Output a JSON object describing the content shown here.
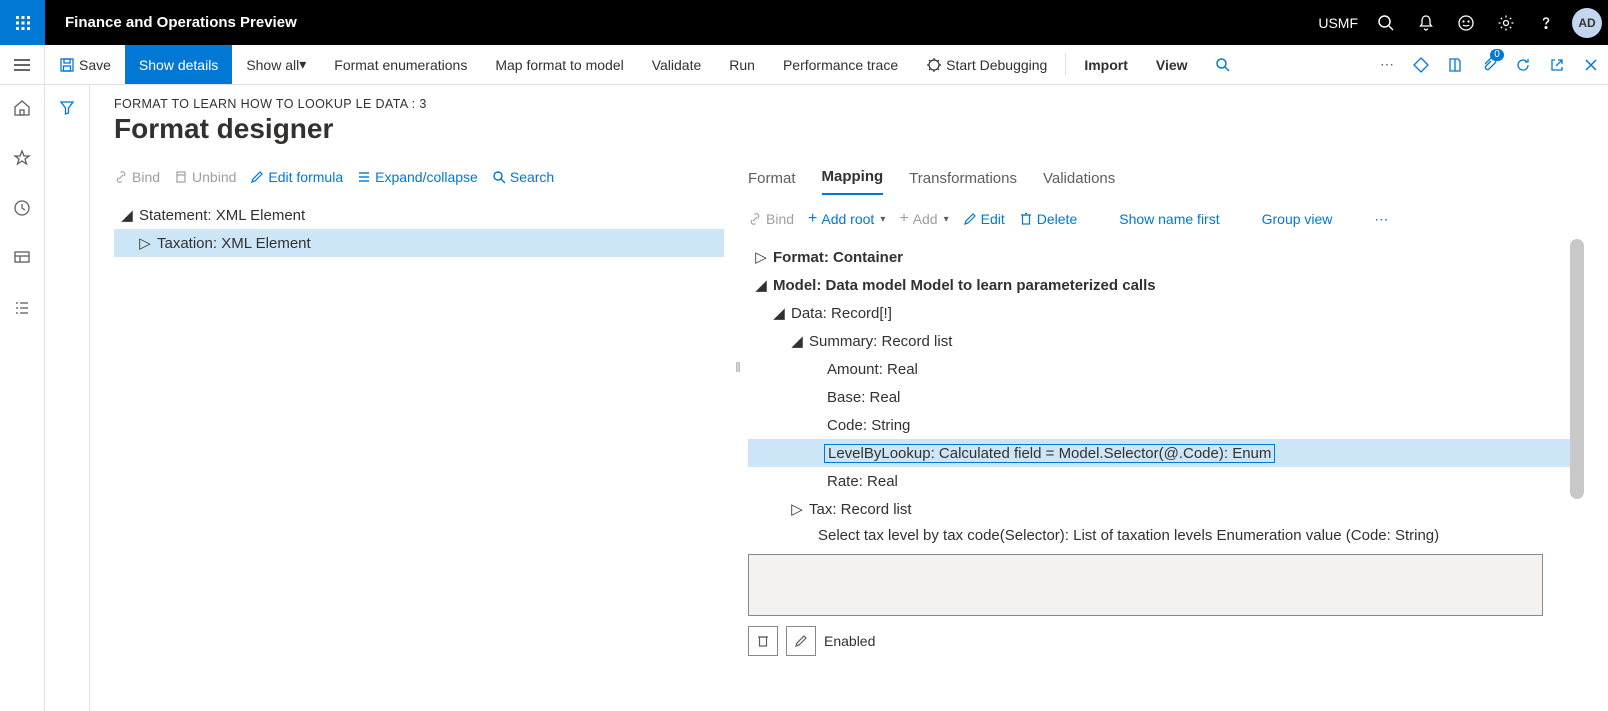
{
  "topbar": {
    "title": "Finance and Operations Preview",
    "company": "USMF",
    "avatar": "AD"
  },
  "actionbar": {
    "save": "Save",
    "show_details": "Show details",
    "show_all": "Show all",
    "format_enum": "Format enumerations",
    "map_format": "Map format to model",
    "validate": "Validate",
    "run": "Run",
    "perf_trace": "Performance trace",
    "start_debug": "Start Debugging",
    "import": "Import",
    "view": "View",
    "badge": "0"
  },
  "page": {
    "crumb": "FORMAT TO LEARN HOW TO LOOKUP LE DATA : 3",
    "title": "Format designer"
  },
  "left_toolbar": {
    "bind": "Bind",
    "unbind": "Unbind",
    "edit_formula": "Edit formula",
    "expand": "Expand/collapse",
    "search": "Search"
  },
  "left_tree": {
    "root": "Statement: XML Element",
    "child": "Taxation: XML Element"
  },
  "tabs": {
    "format": "Format",
    "mapping": "Mapping",
    "transformations": "Transformations",
    "validations": "Validations"
  },
  "right_toolbar": {
    "bind": "Bind",
    "add_root": "Add root",
    "add": "Add",
    "edit": "Edit",
    "delete": "Delete",
    "show_name_first": "Show name first",
    "group_view": "Group view"
  },
  "right_tree": {
    "n0": "Format: Container",
    "n1": "Model: Data model Model to learn parameterized calls",
    "n2": "Data: Record[!]",
    "n3": "Summary: Record list",
    "n3a": "Amount: Real",
    "n3b": "Base: Real",
    "n3c": "Code: String",
    "n3d": "LevelByLookup: Calculated field = Model.Selector(@.Code): Enum",
    "n3e": "Rate: Real",
    "n4": "Tax: Record list",
    "desc": "Select tax level by tax code(Selector): List of taxation levels Enumeration value (Code: String)"
  },
  "footer": {
    "enabled": "Enabled"
  }
}
